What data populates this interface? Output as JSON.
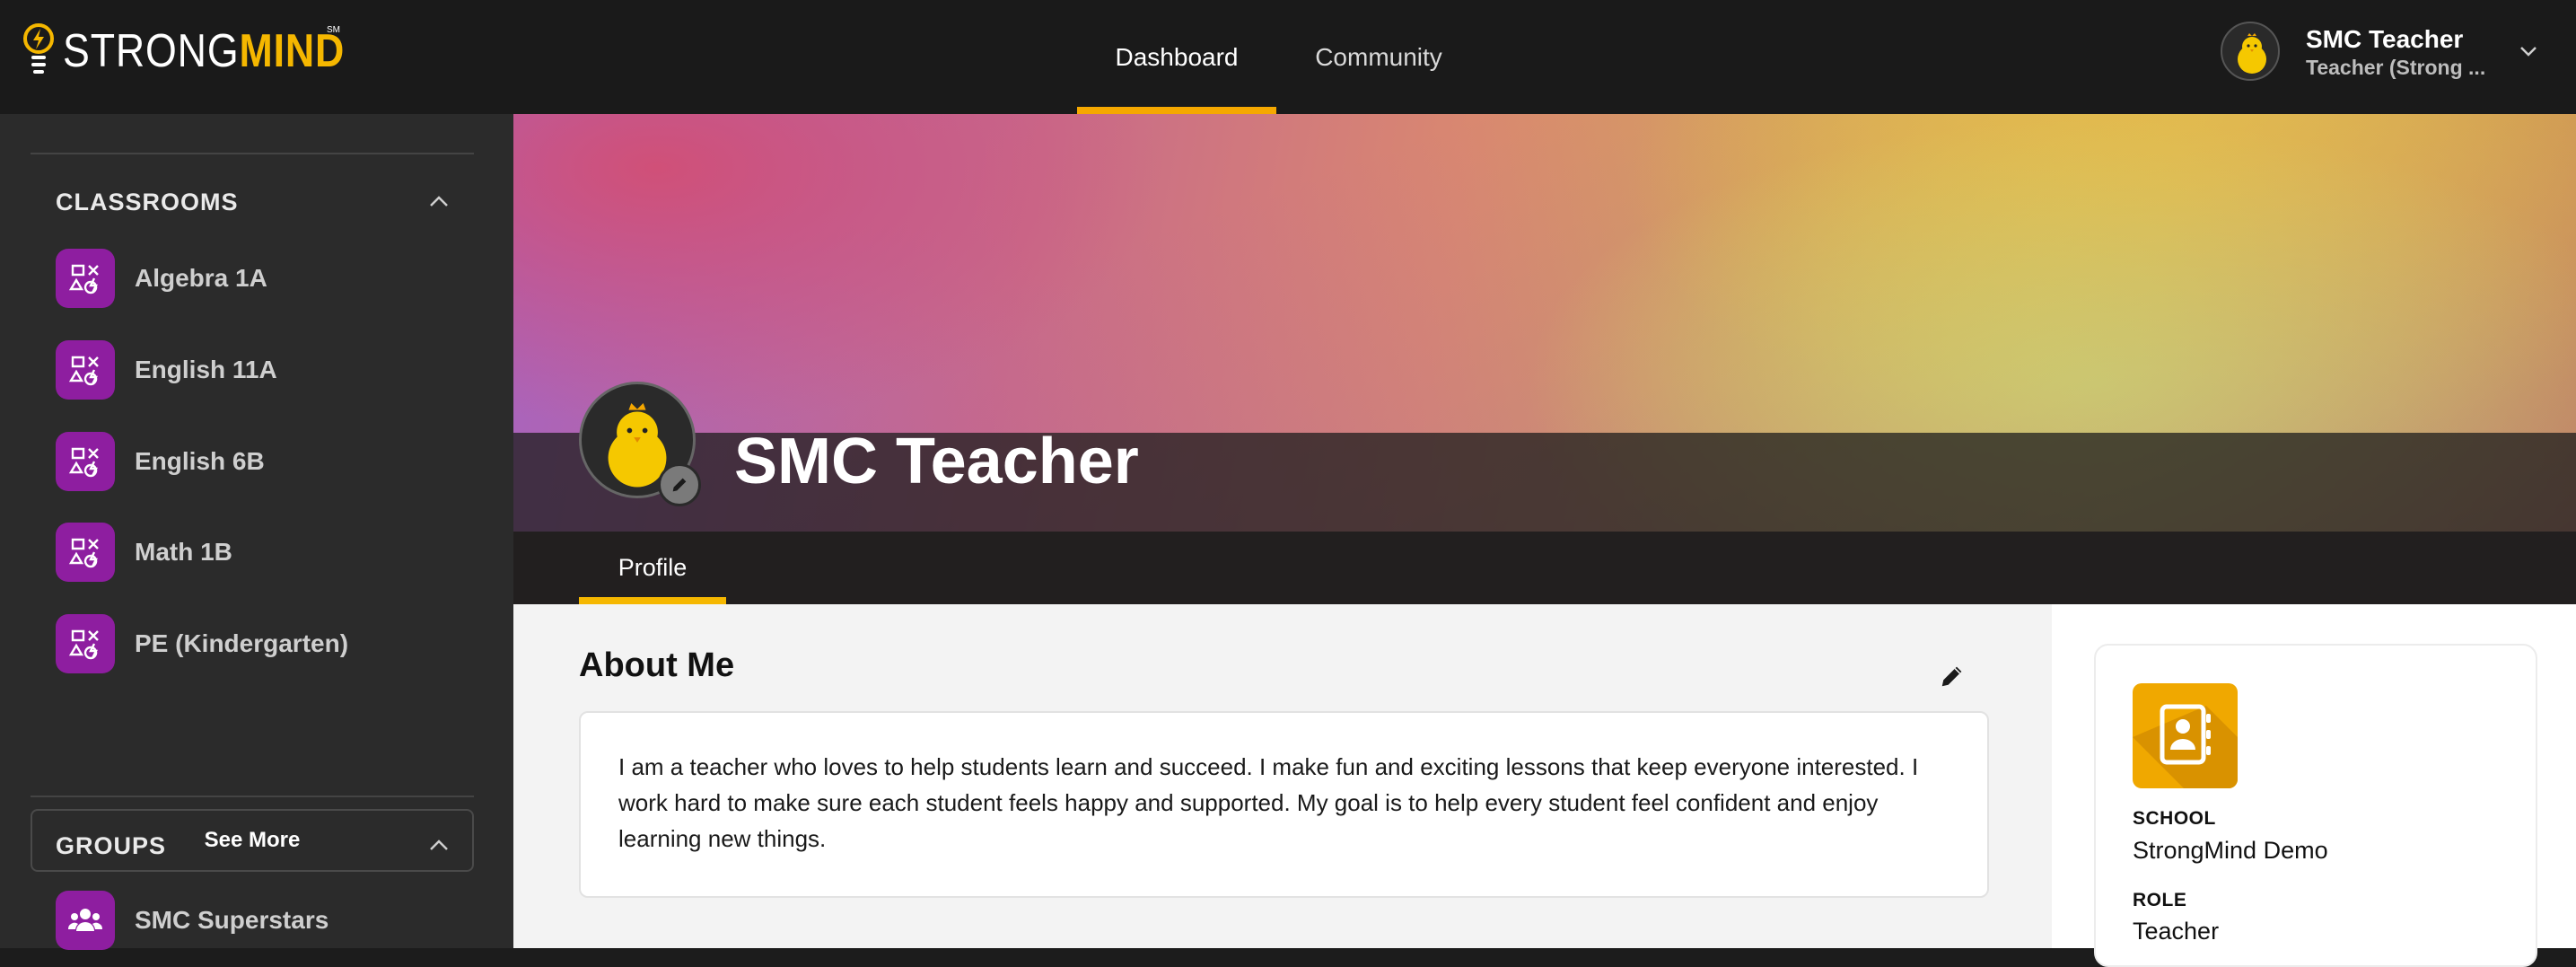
{
  "brand": {
    "name_part1": "STRONG",
    "name_part2": "MIND",
    "mark": "SM",
    "accent": "#f5b700"
  },
  "nav": {
    "tabs": [
      {
        "label": "Dashboard",
        "active": true
      },
      {
        "label": "Community",
        "active": false
      }
    ]
  },
  "user": {
    "name": "SMC Teacher",
    "role": "Teacher (Strong ...",
    "avatar_icon": "chick-avatar-icon"
  },
  "sidebar": {
    "classrooms": {
      "title": "CLASSROOMS",
      "items": [
        {
          "label": "Algebra 1A"
        },
        {
          "label": "English 11A"
        },
        {
          "label": "English 6B"
        },
        {
          "label": "Math 1B"
        },
        {
          "label": "PE (Kindergarten)"
        }
      ],
      "see_more": "See More"
    },
    "groups": {
      "title": "GROUPS",
      "items": [
        {
          "label": "SMC Superstars"
        }
      ]
    },
    "icon_color": "#8e1ea0"
  },
  "profile": {
    "name": "SMC Teacher",
    "tab": "Profile",
    "about": {
      "title": "About Me",
      "text": "I am a teacher who loves to help students learn and succeed. I make fun and exciting lessons that keep everyone interested. I work hard to make sure each student feels happy and supported. My goal is to help every student feel confident and enjoy learning new things."
    },
    "info": {
      "school_label": "SCHOOL",
      "school_value": "StrongMind Demo",
      "role_label": "ROLE",
      "role_value": "Teacher"
    }
  }
}
